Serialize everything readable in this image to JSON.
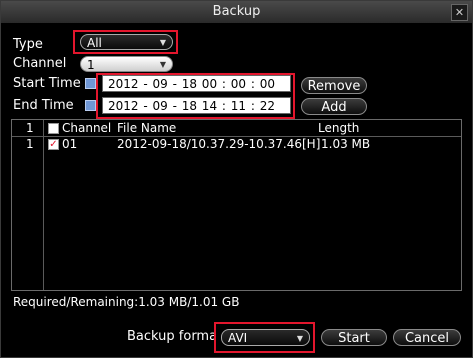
{
  "window": {
    "title": "Backup",
    "close_glyph": "✕"
  },
  "form": {
    "type_label": "Type",
    "type_value": "All",
    "channel_label": "Channel",
    "channel_value": "1",
    "start_label": "Start Time",
    "start_value": "2012 - 09 - 18   00 : 00 : 00",
    "end_label": "End Time",
    "end_value": "2012 - 09 - 18   14 : 11 : 22",
    "remove_label": "Remove",
    "add_label": "Add"
  },
  "list": {
    "header_index": "1",
    "header_channel": "Channel",
    "header_file": "File Name",
    "header_length": "Length",
    "rows": [
      {
        "index": "1",
        "checked": true,
        "channel": "01",
        "file": "2012-09-18/10.37.29-10.37.46[H]",
        "length": "1.03 MB"
      }
    ]
  },
  "status": {
    "text": "Required/Remaining:1.03 MB/1.01 GB"
  },
  "footer": {
    "format_label": "Backup forma",
    "format_value": "AVI",
    "start_label": "Start",
    "cancel_label": "Cancel"
  },
  "icons": {
    "calendar": "calendar-icon",
    "dropdown": "chevron-down-icon",
    "check": "check-icon"
  },
  "colors": {
    "highlight": "#e3162d",
    "calendar": "#6f97d6",
    "titlebar": "#3a3a3a"
  }
}
